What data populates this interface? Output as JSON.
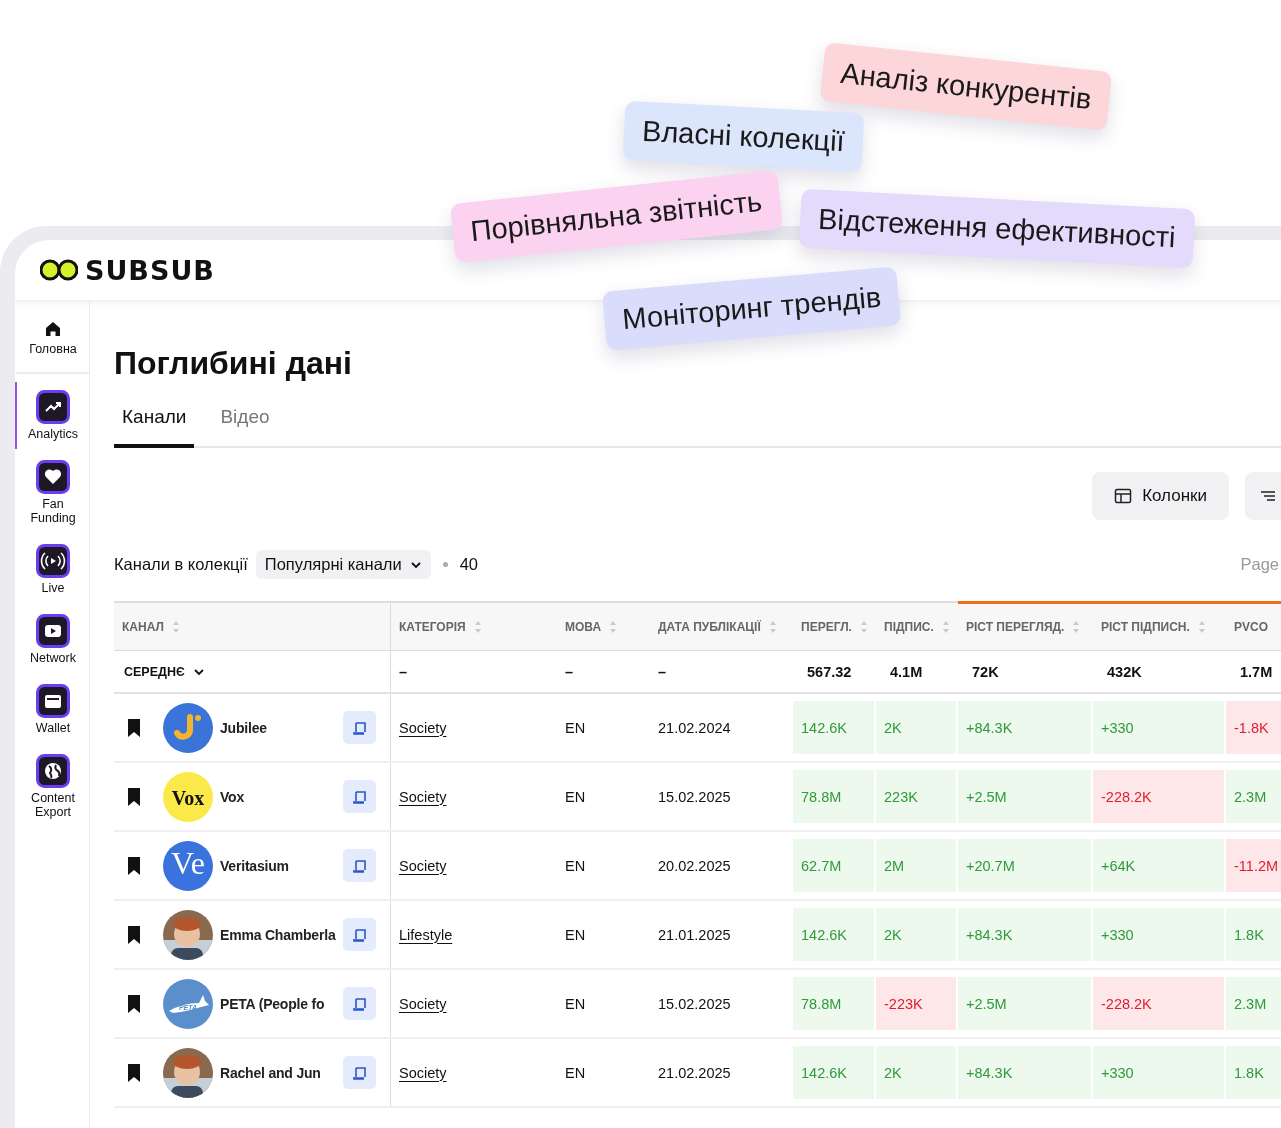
{
  "tags": [
    {
      "label": "Аналіз конкурентів",
      "color": "#fcd6d8"
    },
    {
      "label": "Власні колекції",
      "color": "#dbe5fb"
    },
    {
      "label": "Порівняльна звітність",
      "color": "#fbd3f1"
    },
    {
      "label": "Відстеження ефективності",
      "color": "#e4dafb"
    },
    {
      "label": "Моніторинг трендів",
      "color": "#dadcfb"
    }
  ],
  "logo": "SUBSUB",
  "sidebar": {
    "items": [
      {
        "kind": "home",
        "label": "Головна",
        "selected": false
      },
      {
        "kind": "analytics",
        "label": "Analytics",
        "selected": true
      },
      {
        "kind": "heart",
        "label": "Fan Funding",
        "selected": false
      },
      {
        "kind": "live",
        "label": "Live",
        "selected": false
      },
      {
        "kind": "video",
        "label": "Network",
        "selected": false
      },
      {
        "kind": "wallet",
        "label": "Wallet",
        "selected": false
      },
      {
        "kind": "globe",
        "label": "Content Export",
        "selected": false
      }
    ]
  },
  "title": "Поглибині дані",
  "tabs": [
    {
      "label": "Канали",
      "selected": true
    },
    {
      "label": "Відео",
      "selected": false
    }
  ],
  "columns_button": "Колонки",
  "collection": {
    "label": "Канали в колекції",
    "dropdown": "Популярні канали",
    "count": "40",
    "page": "Page"
  },
  "table": {
    "columns": [
      {
        "label": "КАНАЛ",
        "sortable": true,
        "highlighted": false
      },
      {
        "label": "КАТЕГОРІЯ",
        "sortable": true,
        "highlighted": false
      },
      {
        "label": "МОВА",
        "sortable": true,
        "highlighted": false
      },
      {
        "label": "ДАТА ПУБЛІКАЦІЇ",
        "sortable": true,
        "highlighted": false
      },
      {
        "label": "ПЕРЕГЛ.",
        "sortable": true,
        "highlighted": false
      },
      {
        "label": "ПІДПИС.",
        "sortable": true,
        "highlighted": false
      },
      {
        "label": "РІСТ ПЕРЕГЛЯД.",
        "sortable": true,
        "highlighted": true
      },
      {
        "label": "РІСТ ПІДПИСН.",
        "sortable": true,
        "highlighted": true
      },
      {
        "label": "PVCO",
        "sortable": false,
        "highlighted": true
      }
    ],
    "average": {
      "label": "СЕРЕДНЄ",
      "cells": [
        "–",
        "–",
        "–",
        "567.32",
        "4.1M",
        "72K",
        "432K",
        "1.7M"
      ]
    },
    "rows": [
      {
        "name": "Jubilee",
        "avatar": {
          "kind": "jubilee"
        },
        "category": "Society",
        "language": "EN",
        "date": "21.02.2024",
        "metrics": [
          {
            "value": "142.6K",
            "negative": false
          },
          {
            "value": "2K",
            "negative": false
          },
          {
            "value": "+84.3K",
            "negative": false
          },
          {
            "value": "+330",
            "negative": false
          },
          {
            "value": "-1.8K",
            "negative": true
          }
        ]
      },
      {
        "name": "Vox",
        "avatar": {
          "kind": "text",
          "text": "Vox",
          "color": "#fbe94a"
        },
        "category": "Society",
        "language": "EN",
        "date": "15.02.2025",
        "metrics": [
          {
            "value": "78.8M",
            "negative": false
          },
          {
            "value": "223K",
            "negative": false
          },
          {
            "value": "+2.5M",
            "negative": false
          },
          {
            "value": "-228.2K",
            "negative": true
          },
          {
            "value": "2.3M",
            "negative": false
          }
        ]
      },
      {
        "name": "Veritasium",
        "avatar": {
          "kind": "text",
          "text": "Ve",
          "color": "#3a73de"
        },
        "category": "Society",
        "language": "EN",
        "date": "20.02.2025",
        "metrics": [
          {
            "value": "62.7M",
            "negative": false
          },
          {
            "value": "2M",
            "negative": false
          },
          {
            "value": "+20.7M",
            "negative": false
          },
          {
            "value": "+64K",
            "negative": false
          },
          {
            "value": "-11.2M",
            "negative": true
          }
        ]
      },
      {
        "name": "Emma Chamberla",
        "avatar": {
          "kind": "picture"
        },
        "category": "Lifestyle",
        "language": "EN",
        "date": "21.01.2025",
        "metrics": [
          {
            "value": "142.6K",
            "negative": false
          },
          {
            "value": "2K",
            "negative": false
          },
          {
            "value": "+84.3K",
            "negative": false
          },
          {
            "value": "+330",
            "negative": false
          },
          {
            "value": "1.8K",
            "negative": false
          }
        ]
      },
      {
        "name": "PETA (People fo",
        "avatar": {
          "kind": "rabbit",
          "text": "PETA",
          "color": "#5b8fcb"
        },
        "category": "Society",
        "language": "EN",
        "date": "15.02.2025",
        "metrics": [
          {
            "value": "78.8M",
            "negative": false
          },
          {
            "value": "-223K",
            "negative": true
          },
          {
            "value": "+2.5M",
            "negative": false
          },
          {
            "value": "-228.2K",
            "negative": true
          },
          {
            "value": "2.3M",
            "negative": false
          }
        ]
      },
      {
        "name": "Rachel and Jun",
        "avatar": {
          "kind": "picture"
        },
        "category": "Society",
        "language": "EN",
        "date": "21.02.2025",
        "metrics": [
          {
            "value": "142.6K",
            "negative": false
          },
          {
            "value": "2K",
            "negative": false
          },
          {
            "value": "+84.3K",
            "negative": false
          },
          {
            "value": "+330",
            "negative": false
          },
          {
            "value": "1.8K",
            "negative": false
          }
        ]
      }
    ]
  }
}
